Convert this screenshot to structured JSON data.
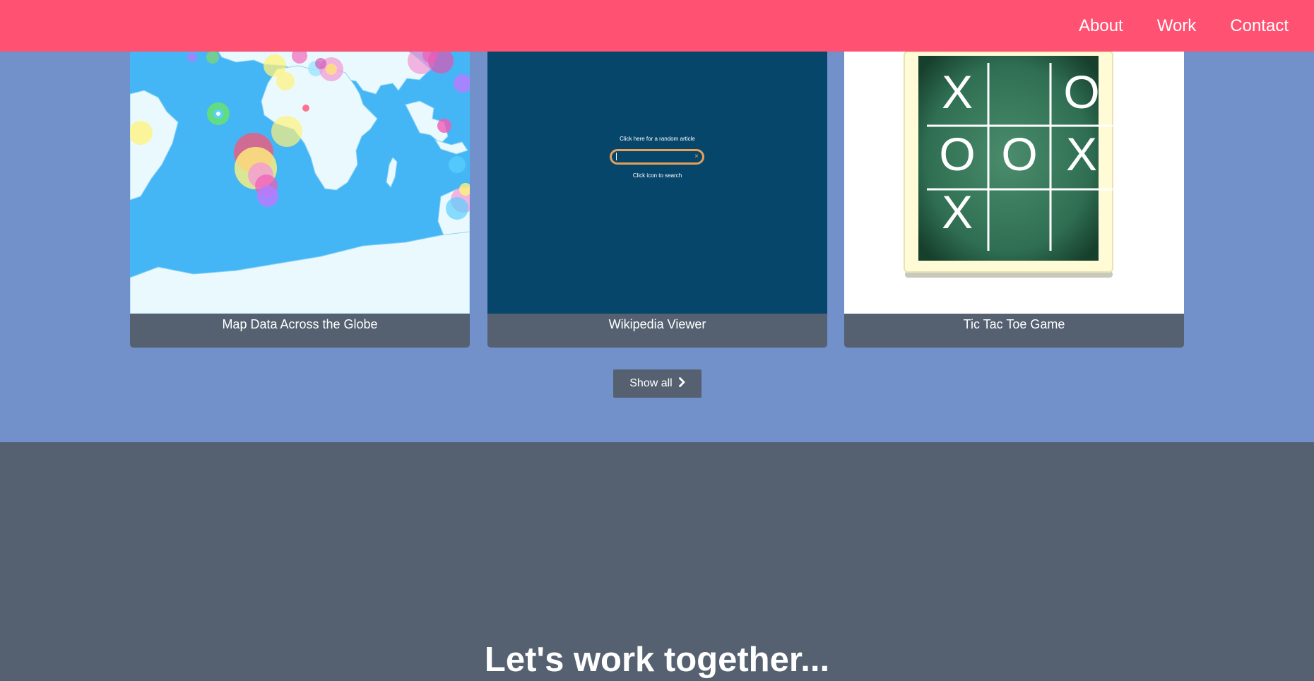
{
  "nav": {
    "items": [
      {
        "label": "About"
      },
      {
        "label": "Work"
      },
      {
        "label": "Contact"
      }
    ]
  },
  "work": {
    "projects": [
      {
        "title": "Map Data Across the Globe",
        "thumbnail": "world-map-thumbnail"
      },
      {
        "title": "Wikipedia Viewer",
        "thumbnail": "wikipedia-viewer-thumbnail",
        "preview": {
          "prompt": "Click here for a random article",
          "hint": "Click icon to search",
          "clear_icon": "×"
        }
      },
      {
        "title": "Tic Tac Toe Game",
        "thumbnail": "tic-tac-toe-thumbnail",
        "board": [
          "X",
          "",
          "O",
          "O",
          "O",
          "X",
          "X",
          "",
          ""
        ]
      }
    ],
    "show_all_label": "Show all",
    "show_all_icon": "chevron-right-icon"
  },
  "contact": {
    "heading": "Let's work together..."
  },
  "colors": {
    "navbar": "#ff5171",
    "work_background": "#7290c9",
    "card_caption": "#556170",
    "contact_background": "#556170",
    "map_ocean": "#45b6f5",
    "wiki_background": "#07466b",
    "wiki_search_border": "#e8a058",
    "chalkboard": "#2f6e52",
    "board_frame": "#fffbd6"
  }
}
